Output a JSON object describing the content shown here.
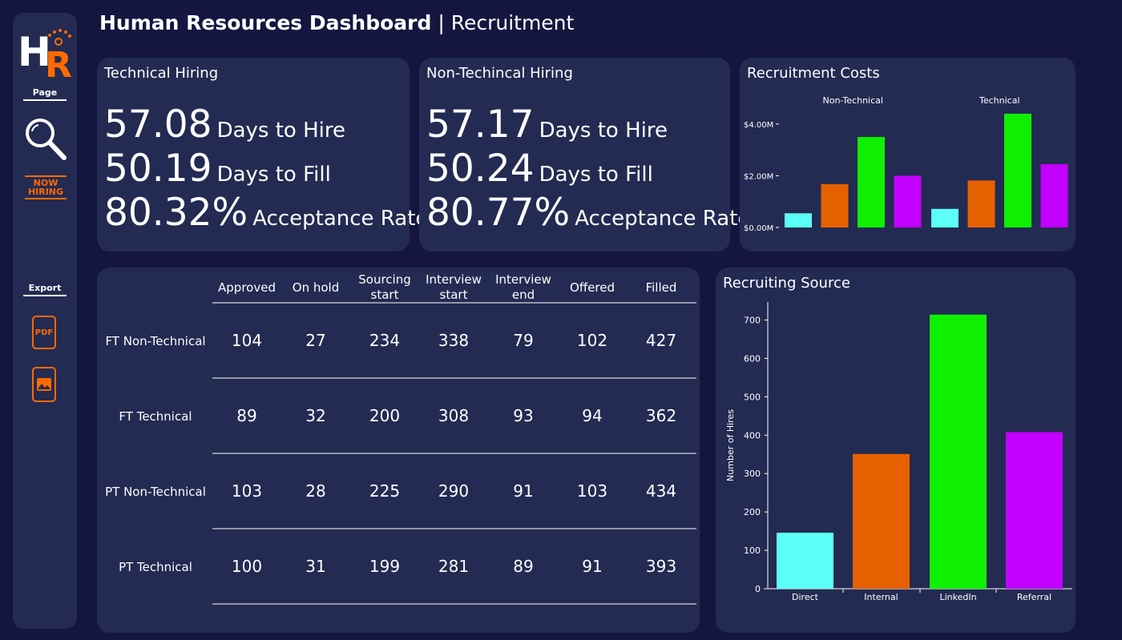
{
  "header": {
    "title": "Human Resources Dashboard",
    "separator": "|",
    "subtitle": "Recruitment"
  },
  "sidebar": {
    "logo": {
      "letters": "HR",
      "accent": "#ff6a00"
    },
    "page_label": "Page",
    "page_icons": [
      "search-icon",
      "now-hiring-icon"
    ],
    "now_hiring_line1": "NOW",
    "now_hiring_line2": "HIRING",
    "export_label": "Export",
    "export_icons": [
      "pdf-icon",
      "image-icon"
    ],
    "pdf_text": "PDF"
  },
  "technical": {
    "title": "Technical Hiring",
    "days_to_hire": "57.08",
    "days_to_hire_label": "Days to Hire",
    "days_to_fill": "50.19",
    "days_to_fill_label": "Days to Fill",
    "acceptance": "80.32%",
    "acceptance_label": "Acceptance Rate"
  },
  "non_technical": {
    "title": "Non-Techincal Hiring",
    "days_to_hire": "57.17",
    "days_to_hire_label": "Days to Hire",
    "days_to_fill": "50.24",
    "days_to_fill_label": "Days to Fill",
    "acceptance": "80.77%",
    "acceptance_label": "Acceptance Rate"
  },
  "costs": {
    "title": "Recruitment Costs"
  },
  "table": {
    "columns": [
      {
        "l1": "Approved",
        "l2": ""
      },
      {
        "l1": "On hold",
        "l2": ""
      },
      {
        "l1": "Sourcing",
        "l2": "start"
      },
      {
        "l1": "Interview",
        "l2": "start"
      },
      {
        "l1": "Interview",
        "l2": "end"
      },
      {
        "l1": "Offered",
        "l2": ""
      },
      {
        "l1": "Filled",
        "l2": ""
      }
    ],
    "rows": [
      {
        "label": "FT Non-Technical",
        "values": [
          "104",
          "27",
          "234",
          "338",
          "79",
          "102",
          "427"
        ]
      },
      {
        "label": "FT Technical",
        "values": [
          "89",
          "32",
          "200",
          "308",
          "93",
          "94",
          "362"
        ]
      },
      {
        "label": "PT Non-Technical",
        "values": [
          "103",
          "28",
          "225",
          "290",
          "91",
          "103",
          "434"
        ]
      },
      {
        "label": "PT Technical",
        "values": [
          "100",
          "31",
          "199",
          "281",
          "89",
          "91",
          "393"
        ]
      }
    ]
  },
  "source": {
    "title": "Recruiting Source"
  },
  "colors": {
    "direct": "#5cfff5",
    "internal": "#e56100",
    "linkedin": "#0ff000",
    "referral": "#c300ff",
    "card": "#232b52",
    "background": "#15163f"
  },
  "chart_data": [
    {
      "type": "bar",
      "title": "Recruitment Costs",
      "groups": [
        "Non-Technical",
        "Technical"
      ],
      "series": [
        {
          "name": "Direct",
          "color": "#5cfff5",
          "values": [
            0.55,
            0.72
          ]
        },
        {
          "name": "Internal",
          "color": "#e56100",
          "values": [
            1.68,
            1.82
          ]
        },
        {
          "name": "LinkedIn",
          "color": "#0ff000",
          "values": [
            3.5,
            4.4
          ]
        },
        {
          "name": "Referral",
          "color": "#c300ff",
          "values": [
            2.0,
            2.45
          ]
        }
      ],
      "ylim": [
        0,
        4.4
      ],
      "yticks": [
        0,
        2,
        4
      ],
      "ytick_labels": [
        "$0.00M",
        "$2.00M",
        "$4.00M"
      ],
      "grid": false
    },
    {
      "type": "bar",
      "title": "Recruiting Source",
      "categories": [
        "Direct",
        "Internal",
        "LinkedIn",
        "Referral"
      ],
      "values": [
        146,
        351,
        714,
        408
      ],
      "colors": [
        "#5cfff5",
        "#e56100",
        "#0ff000",
        "#c300ff"
      ],
      "ylabel": "Number of Hires",
      "ylim": [
        0,
        750
      ],
      "yticks": [
        0,
        100,
        200,
        300,
        400,
        500,
        600,
        700
      ],
      "grid": false
    }
  ]
}
